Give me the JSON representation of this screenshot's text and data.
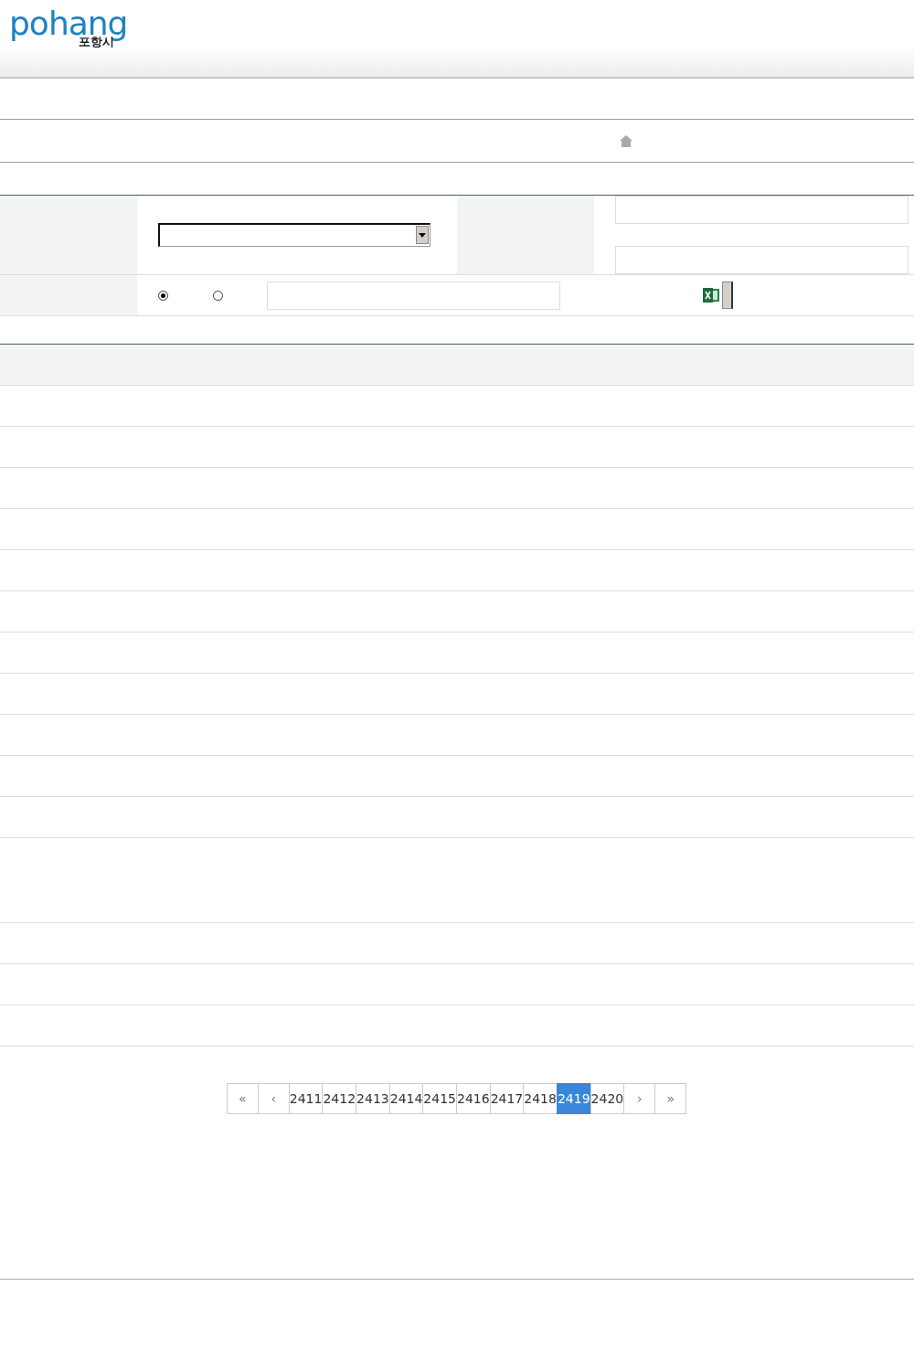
{
  "logo": {
    "wordmark": "pohang",
    "city": "포항시"
  },
  "search": {
    "radios": [
      {
        "selected": true
      },
      {
        "selected": false
      }
    ]
  },
  "pagination": {
    "first": "«",
    "prev": "‹",
    "next": "›",
    "last": "»",
    "pages": [
      {
        "label": "2411",
        "selected": false
      },
      {
        "label": "2412",
        "selected": false
      },
      {
        "label": "2413",
        "selected": false
      },
      {
        "label": "2414",
        "selected": false
      },
      {
        "label": "2415",
        "selected": false
      },
      {
        "label": "2416",
        "selected": false
      },
      {
        "label": "2417",
        "selected": false
      },
      {
        "label": "2418",
        "selected": false
      },
      {
        "label": "2419",
        "selected": true
      },
      {
        "label": "2420",
        "selected": false
      }
    ]
  }
}
